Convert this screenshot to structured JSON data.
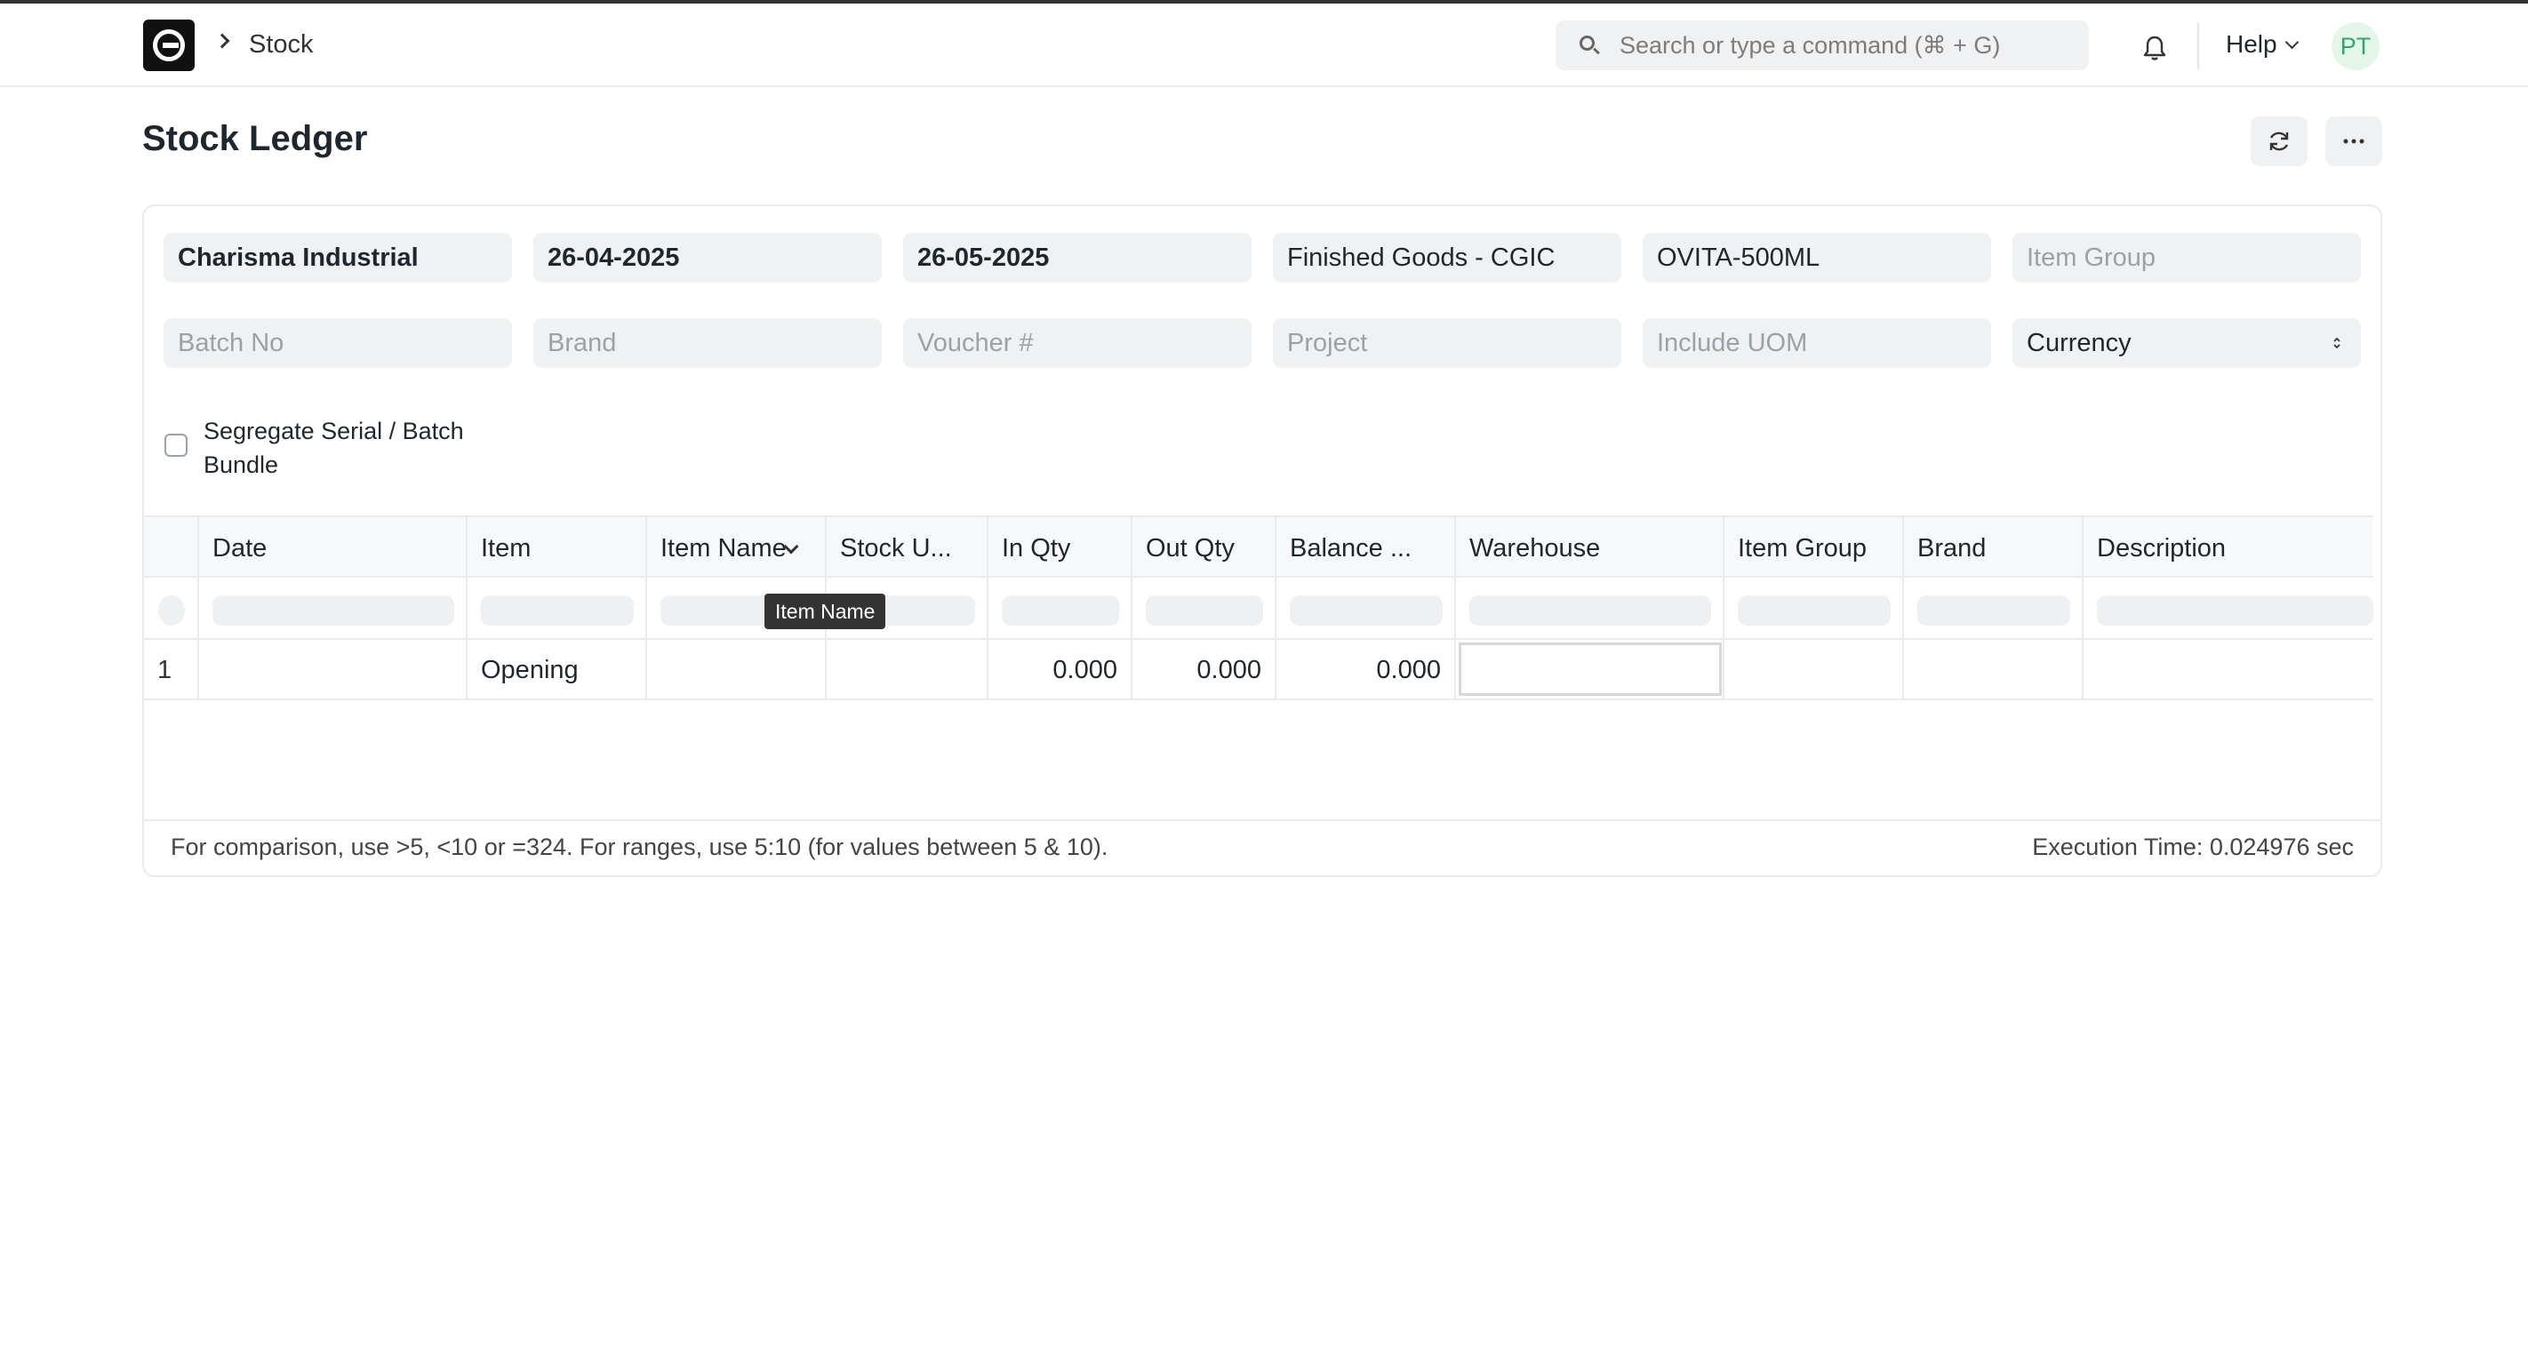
{
  "breadcrumb": {
    "module": "Stock"
  },
  "search": {
    "placeholder": "Search or type a command (⌘ + G)"
  },
  "navbar": {
    "help_label": "Help",
    "avatar_initials": "PT"
  },
  "page": {
    "title": "Stock Ledger"
  },
  "filters": {
    "company": "Charisma Industrial",
    "from_date": "26-04-2025",
    "to_date": "26-05-2025",
    "warehouse": "Finished Goods - CGIC",
    "item": "OVITA-500ML",
    "item_group_placeholder": "Item Group",
    "batch_no_placeholder": "Batch No",
    "brand_placeholder": "Brand",
    "voucher_placeholder": "Voucher #",
    "project_placeholder": "Project",
    "include_uom_placeholder": "Include UOM",
    "currency": "Currency",
    "segregate_label": "Segregate Serial / Batch Bundle",
    "segregate_checked": false
  },
  "table": {
    "columns": [
      "Date",
      "Item",
      "Item Name",
      "Stock U...",
      "In Qty",
      "Out Qty",
      "Balance ...",
      "Warehouse",
      "Item Group",
      "Brand",
      "Description"
    ],
    "rows": [
      {
        "index": "1",
        "date": "",
        "item": "Opening",
        "item_name": "",
        "stock_uom": "",
        "in_qty": "0.000",
        "out_qty": "0.000",
        "balance_qty": "0.000",
        "warehouse": "",
        "item_group": "",
        "brand": "",
        "description": ""
      }
    ],
    "tooltip": "Item Name"
  },
  "footer": {
    "hint": "For comparison, use >5, <10 or =324. For ranges, use 5:10 (for values between 5 & 10).",
    "execution_time": "Execution Time: 0.024976 sec"
  },
  "colors": {
    "accent_green": "#30a66d",
    "field_bg": "#f0f1f2",
    "border": "#e8ebed"
  }
}
